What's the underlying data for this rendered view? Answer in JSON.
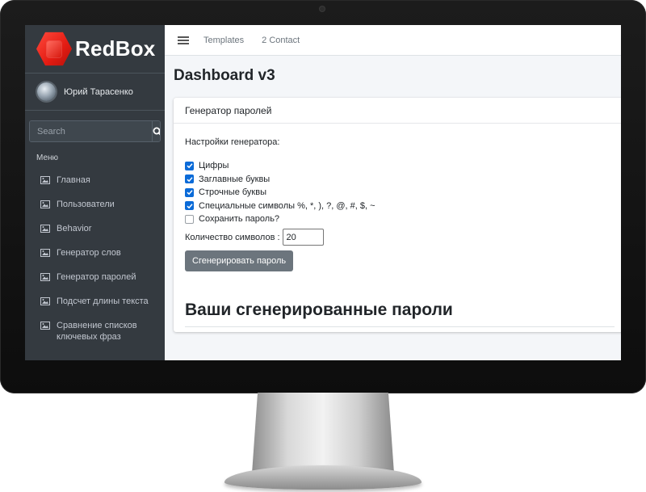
{
  "brand": {
    "name": "RedBox"
  },
  "user": {
    "name": "Юрий Тарасенко"
  },
  "search": {
    "placeholder": "Search"
  },
  "sidebar": {
    "header": "Меню",
    "items": [
      {
        "label": "Главная",
        "icon": "image-icon"
      },
      {
        "label": "Пользователи",
        "icon": "image-icon"
      },
      {
        "label": "Behavior",
        "icon": "image-icon"
      },
      {
        "label": "Генератор слов",
        "icon": "image-icon"
      },
      {
        "label": "Генератор паролей",
        "icon": "image-icon"
      },
      {
        "label": "Подсчет длины текста",
        "icon": "image-icon"
      },
      {
        "label": "Сравнение списков ключевых фраз",
        "icon": "image-icon"
      }
    ]
  },
  "topbar": {
    "links": [
      "Templates",
      "2 Contact"
    ]
  },
  "page": {
    "title": "Dashboard v3"
  },
  "card": {
    "title": "Генератор паролей",
    "settings_label": "Настройки генератора:",
    "options": [
      {
        "label": "Цифры",
        "checked": true
      },
      {
        "label": "Заглавные буквы",
        "checked": true
      },
      {
        "label": "Строчные буквы",
        "checked": true
      },
      {
        "label": "Специальные символы %, *, ), ?, @, #, $, ~",
        "checked": true
      },
      {
        "label": "Сохранить пароль?",
        "checked": false
      }
    ],
    "count_label": "Количество символов :",
    "count_value": "20",
    "button_label": "Сгенерировать пароль",
    "results_title": "Ваши сгенерированные пароли"
  },
  "colors": {
    "sidebar": "#343a40",
    "checkbox": "#0b6bd8",
    "button": "#6c757d",
    "brand_red": "#e31b12"
  }
}
